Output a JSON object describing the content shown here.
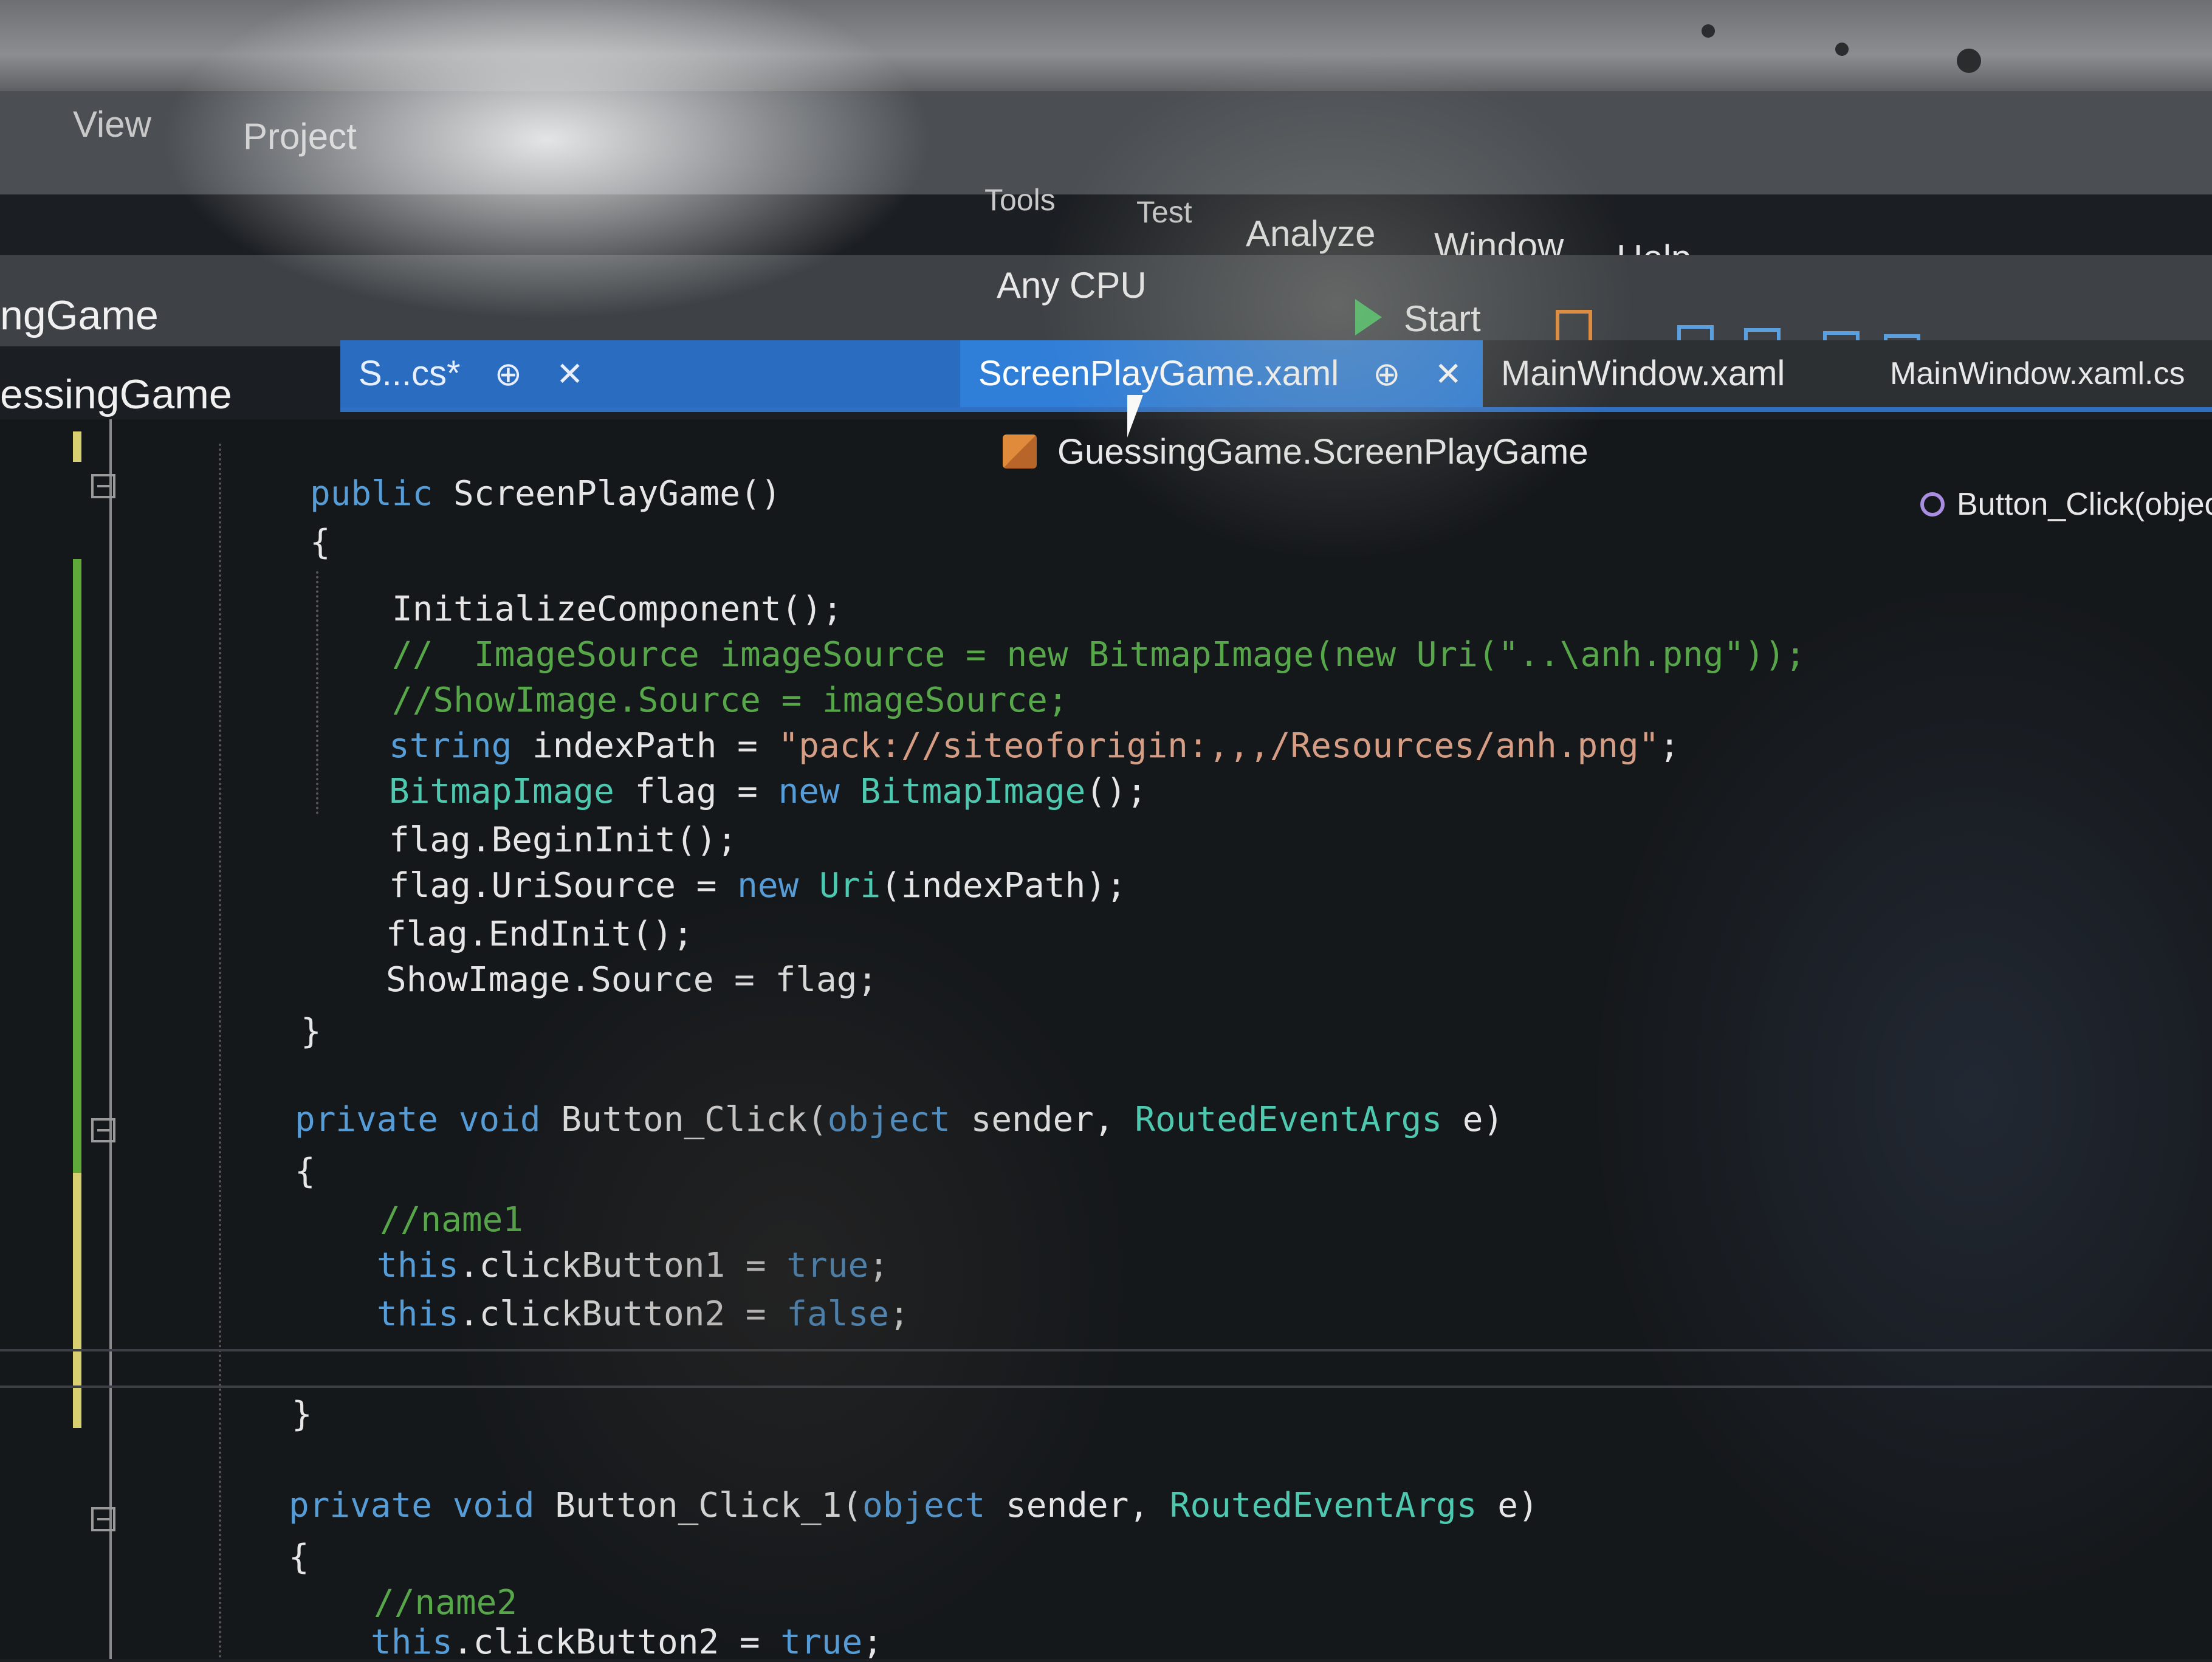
{
  "menu": {
    "view": "View",
    "project": "Project",
    "tools": "Tools",
    "test": "Test",
    "analyze": "Analyze",
    "window": "Window",
    "help": "Help"
  },
  "toolbar": {
    "platform": "Any CPU",
    "start": "Start"
  },
  "project": {
    "title_top": "ngGame",
    "title_solution": "essingGame"
  },
  "tabs": [
    {
      "label": "S...cs*",
      "pin": "⊕",
      "close": "✕"
    },
    {
      "label": "ScreenPlayGame.xaml",
      "pin": "⊕",
      "close": "✕"
    },
    {
      "label": "MainWindow.xaml"
    },
    {
      "label": "MainWindow.xaml.cs"
    }
  ],
  "nav": {
    "class_path": "GuessingGame.ScreenPlayGame",
    "member": "Button_Click(object"
  },
  "code": {
    "l1_kw": "public",
    "l1_rest": " ScreenPlayGame()",
    "l2": "{",
    "l3": "InitializeComponent();",
    "l4": "//  ImageSource imageSource = new BitmapImage(new Uri(\"..\\anh.png\"));",
    "l5": "//ShowImage.Source = imageSource;",
    "l6_kw": "string",
    "l6_mid": " indexPath = ",
    "l6_str": "\"pack://siteoforigin:,,,/Resources/anh.png\"",
    "l6_end": ";",
    "l7_ty": "BitmapImage",
    "l7_mid": " flag = ",
    "l7_kw": "new",
    "l7_ty2": " BitmapImage",
    "l7_end": "();",
    "l8": "flag.BeginInit();",
    "l9_a": "flag.UriSource = ",
    "l9_kw": "new",
    "l9_ty": " Uri",
    "l9_end": "(indexPath);",
    "l10": "flag.EndInit();",
    "l11": "ShowImage.Source = flag;",
    "l12": "}",
    "l13_kw": "private void",
    "l13_mid": " Button_Click(",
    "l13_kw2": "object",
    "l13_mid2": " sender, ",
    "l13_ty": "RoutedEventArgs",
    "l13_end": " e)",
    "l14": "{",
    "l15": "//name1",
    "l16_kw": "this",
    "l16_mid": ".clickButton1 = ",
    "l16_val": "true",
    "l16_end": ";",
    "l17_kw": "this",
    "l17_mid": ".clickButton2 = ",
    "l17_val": "false",
    "l17_end": ";",
    "l18": "}",
    "l19_kw": "private void",
    "l19_mid": " Button_Click_1(",
    "l19_kw2": "object",
    "l19_mid2": " sender, ",
    "l19_ty": "RoutedEventArgs",
    "l19_end": " e)",
    "l20": "{",
    "l21": "//name2",
    "l22_kw": "this",
    "l22_mid": ".clickButton2 = ",
    "l22_val": "true",
    "l22_end": ";"
  }
}
